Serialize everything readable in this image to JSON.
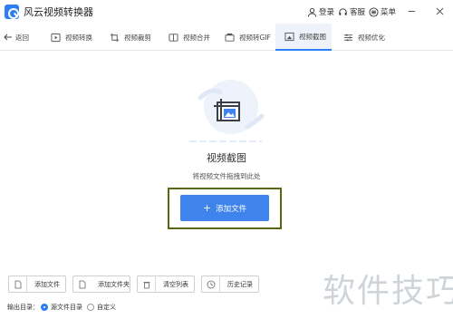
{
  "titlebar": {
    "app_title": "风云视频转换器",
    "login_label": "登录",
    "service_label": "客服",
    "menu_label": "菜单"
  },
  "toolbar": {
    "back_label": "返回",
    "tools": [
      {
        "label": "视频转换",
        "icon": "video-convert-icon"
      },
      {
        "label": "视频裁剪",
        "icon": "video-crop-icon"
      },
      {
        "label": "视频合并",
        "icon": "video-merge-icon"
      },
      {
        "label": "视频转GIF",
        "icon": "video-gif-icon"
      },
      {
        "label": "视频截图",
        "icon": "video-screenshot-icon",
        "active": true
      },
      {
        "label": "视频优化",
        "icon": "video-optimize-icon"
      }
    ]
  },
  "main": {
    "title": "视频截图",
    "hint": "将视频文件拖拽到此处",
    "add_button_label": "添加文件"
  },
  "bottom": {
    "buttons": [
      {
        "label": "添加文件",
        "icon": "file-icon"
      },
      {
        "label": "添加文件夹",
        "icon": "folder-icon"
      },
      {
        "label": "清空列表",
        "icon": "trash-icon"
      },
      {
        "label": "历史记录",
        "icon": "clock-icon"
      }
    ],
    "output_label": "输出目录：",
    "options": [
      {
        "label": "源文件目录",
        "selected": true
      },
      {
        "label": "自定义",
        "selected": false
      }
    ]
  },
  "watermark": "软件技巧",
  "colors": {
    "accent": "#3f84ec",
    "highlight_frame": "#5c6612"
  }
}
